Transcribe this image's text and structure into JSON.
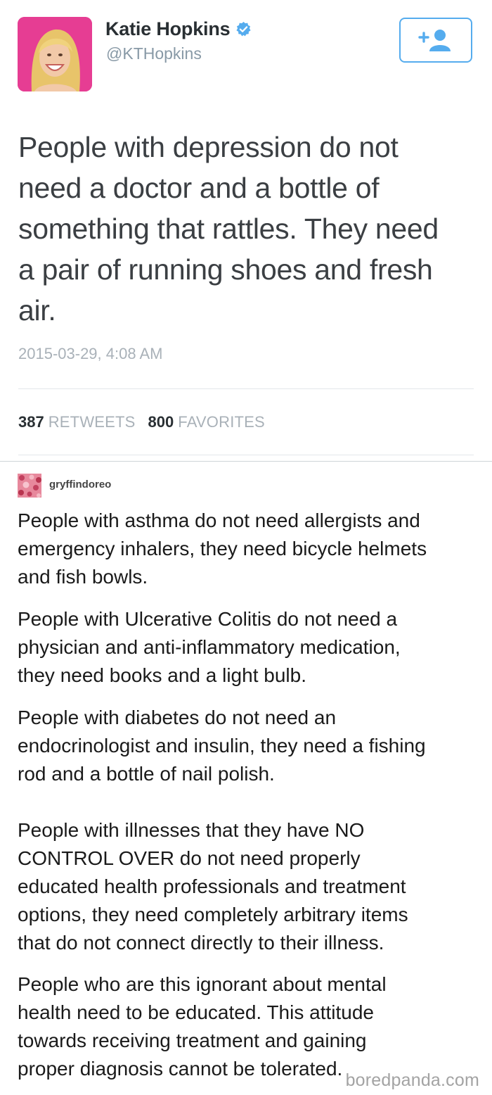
{
  "tweet": {
    "display_name": "Katie Hopkins",
    "handle": "@KTHopkins",
    "follow_icon": "add-user-icon",
    "verified_icon": "verified-badge-icon",
    "lines": [
      "People with depression do not",
      "need a doctor and a bottle of",
      "something that rattles. They need",
      "a pair of running shoes and fresh",
      "air."
    ],
    "timestamp": "2015-03-29, 4:08 AM",
    "retweets_count": "387",
    "retweets_label": "RETWEETS",
    "favorites_count": "800",
    "favorites_label": "FAVORITES",
    "colors": {
      "accent": "#55acee",
      "muted": "#a9b1b8"
    }
  },
  "reply": {
    "username": "gryffindoreo",
    "paragraphs": [
      [
        "People with asthma do not need allergists and",
        "emergency inhalers, they need bicycle helmets",
        "and fish bowls."
      ],
      [
        "People with Ulcerative Colitis do not need a",
        "physician and anti-inflammatory medication,",
        "they need books and a light bulb."
      ],
      [
        "People with diabetes do not need an",
        "endocrinologist and insulin, they need a fishing",
        "rod and a bottle of nail polish."
      ],
      [
        "People with illnesses that they have NO",
        "CONTROL OVER do not need properly",
        "educated health professionals and treatment",
        "options, they need completely arbitrary items",
        "that do not connect directly to their illness."
      ],
      [
        "People who are this ignorant about mental",
        "health need to be educated. This attitude",
        "towards receiving treatment and gaining",
        "proper diagnosis cannot be tolerated."
      ]
    ]
  },
  "watermark": "boredpanda.com"
}
